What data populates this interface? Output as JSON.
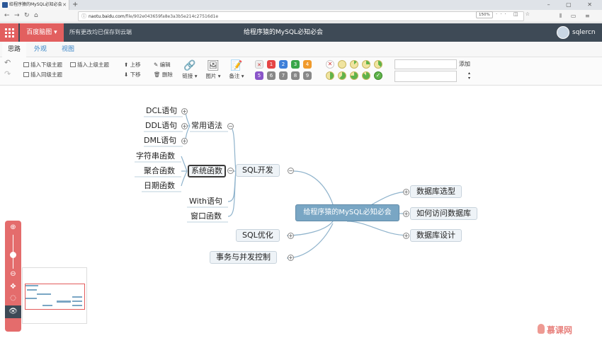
{
  "browser": {
    "tab_title": "给程序猿的MySQL必知必会",
    "new_tab": "+",
    "url_host": "naotu.baidu.com",
    "url_path": "/file/902e043659fa8e3a3b5e214c27516d1e",
    "zoom": "150%"
  },
  "app": {
    "brand": "百度脑图",
    "save_hint": "所有更改均已保存到云端",
    "doc_title": "给程序猿的MySQL必知必会",
    "username": "sqlercn"
  },
  "ribbon": {
    "tabs": [
      "思路",
      "外观",
      "视图"
    ]
  },
  "toolbar": {
    "insert_child": "插入下级主题",
    "insert_parent": "插入上级主题",
    "insert_sibling": "插入同级主题",
    "move_up": "上移",
    "move_down": "下移",
    "edit": "编辑",
    "delete": "删除",
    "link": "链接",
    "image": "图片",
    "note": "备注",
    "priorities": [
      "1",
      "2",
      "3",
      "4",
      "5",
      "6",
      "7",
      "8",
      "9"
    ],
    "add_label": "添加"
  },
  "mindmap": {
    "root": "给程序猿的MySQL必知必会",
    "sql_dev": "SQL开发",
    "common_syntax": "常用语法",
    "dcl": "DCL语句",
    "ddl": "DDL语句",
    "dml": "DML语句",
    "sys_func": "系统函数",
    "string_func": "字符串函数",
    "agg_func": "聚合函数",
    "date_func": "日期函数",
    "with_stmt": "With语句",
    "window_func": "窗口函数",
    "sql_opt": "SQL优化",
    "txn": "事务与并发控制",
    "db_select": "数据库选型",
    "db_access": "如何访问数据库",
    "db_design": "数据库设计"
  },
  "watermark": "慕课网",
  "colors": {
    "header_bg": "#3e4a56",
    "brand_red": "#e25f5f",
    "root_node": "#79a6c4",
    "edge": "#8fb3cc"
  }
}
